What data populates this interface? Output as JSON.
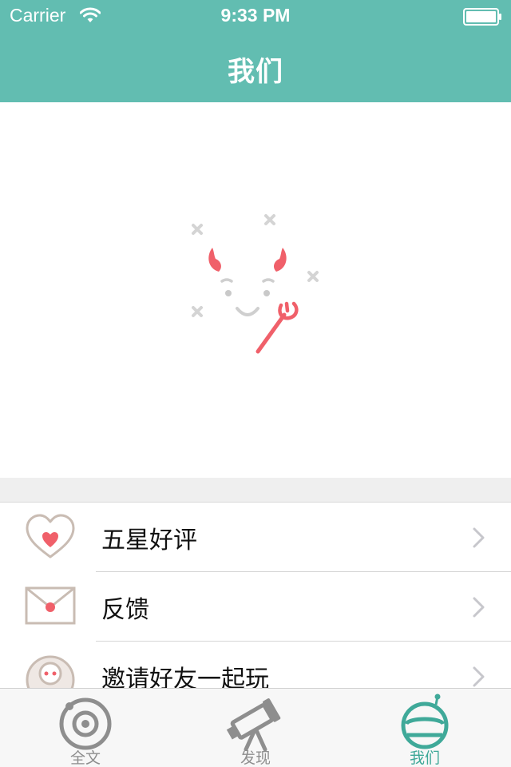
{
  "status_bar": {
    "carrier": "Carrier",
    "time": "9:33 PM",
    "wifi_icon": "wifi-icon",
    "battery_icon": "battery-icon"
  },
  "header": {
    "title": "我们",
    "background_color": "#62bdb1"
  },
  "hero": {
    "illustration": "devil-face-illustration"
  },
  "menu": {
    "items": [
      {
        "icon": "heart-icon",
        "label": "五星好评"
      },
      {
        "icon": "envelope-icon",
        "label": "反馈"
      },
      {
        "icon": "friend-avatar-icon",
        "label": "邀请好友一起玩"
      }
    ],
    "chevron_icon": "chevron-right-icon"
  },
  "tab_bar": {
    "tabs": [
      {
        "icon": "planet-icon",
        "label": "全文",
        "active": false
      },
      {
        "icon": "telescope-icon",
        "label": "发现",
        "active": false
      },
      {
        "icon": "astronaut-helmet-icon",
        "label": "我们",
        "active": true
      }
    ],
    "active_color": "#3fa999",
    "inactive_color": "#8e8e8e"
  }
}
